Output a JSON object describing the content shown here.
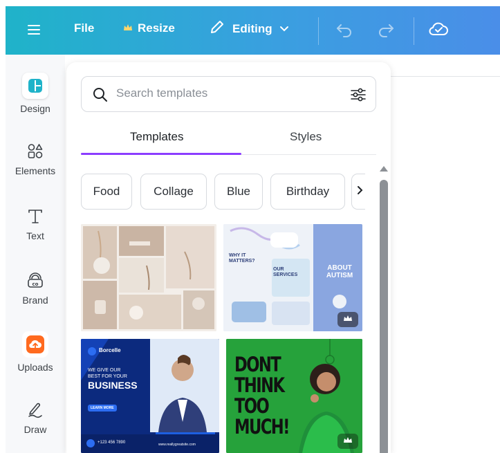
{
  "topbar": {
    "file_label": "File",
    "resize_label": "Resize",
    "editing_label": "Editing"
  },
  "sidebar": {
    "items": [
      {
        "label": "Design",
        "icon": "design-icon"
      },
      {
        "label": "Elements",
        "icon": "elements-icon"
      },
      {
        "label": "Text",
        "icon": "text-icon"
      },
      {
        "label": "Brand",
        "icon": "brand-icon"
      },
      {
        "label": "Uploads",
        "icon": "uploads-icon"
      },
      {
        "label": "Draw",
        "icon": "draw-icon"
      }
    ]
  },
  "panel": {
    "search": {
      "placeholder": "Search templates",
      "value": ""
    },
    "tabs": [
      {
        "label": "Templates",
        "active": true
      },
      {
        "label": "Styles",
        "active": false
      }
    ],
    "chips": [
      "Food",
      "Collage",
      "Blue",
      "Birthday"
    ],
    "templates": {
      "t2": {
        "why_it_matters": "WHY IT MATTERS?",
        "our_services": "OUR SERVICES",
        "about_autism": "ABOUT AUTISM"
      },
      "t3": {
        "brand": "Borcelle",
        "line1": "WE GIVE OUR",
        "line2": "BEST FOR YOUR",
        "line3": "BUSINESS",
        "cta": "LEARN MORE",
        "phone": "+123 456 7890",
        "site": "www.reallygreatsite.com"
      },
      "t4": {
        "line1": "DONT",
        "line2": "THINK",
        "line3": "TOO",
        "line4": "MUCH!"
      }
    }
  },
  "colors": {
    "accent": "#8b3dff",
    "topbar_start": "#1fb3c9",
    "topbar_end": "#4a8ee8",
    "uploads_orange": "#ff6a1f",
    "design_teal": "#1fb3c9"
  }
}
